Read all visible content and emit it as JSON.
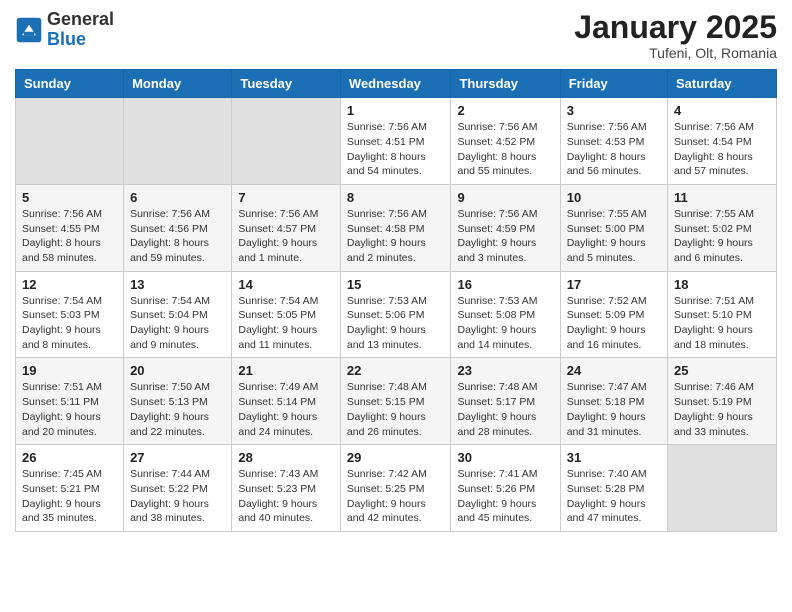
{
  "header": {
    "logo_general": "General",
    "logo_blue": "Blue",
    "month_title": "January 2025",
    "location": "Tufeni, Olt, Romania"
  },
  "weekdays": [
    "Sunday",
    "Monday",
    "Tuesday",
    "Wednesday",
    "Thursday",
    "Friday",
    "Saturday"
  ],
  "weeks": [
    [
      {
        "day": "",
        "info": ""
      },
      {
        "day": "",
        "info": ""
      },
      {
        "day": "",
        "info": ""
      },
      {
        "day": "1",
        "info": "Sunrise: 7:56 AM\nSunset: 4:51 PM\nDaylight: 8 hours\nand 54 minutes."
      },
      {
        "day": "2",
        "info": "Sunrise: 7:56 AM\nSunset: 4:52 PM\nDaylight: 8 hours\nand 55 minutes."
      },
      {
        "day": "3",
        "info": "Sunrise: 7:56 AM\nSunset: 4:53 PM\nDaylight: 8 hours\nand 56 minutes."
      },
      {
        "day": "4",
        "info": "Sunrise: 7:56 AM\nSunset: 4:54 PM\nDaylight: 8 hours\nand 57 minutes."
      }
    ],
    [
      {
        "day": "5",
        "info": "Sunrise: 7:56 AM\nSunset: 4:55 PM\nDaylight: 8 hours\nand 58 minutes."
      },
      {
        "day": "6",
        "info": "Sunrise: 7:56 AM\nSunset: 4:56 PM\nDaylight: 8 hours\nand 59 minutes."
      },
      {
        "day": "7",
        "info": "Sunrise: 7:56 AM\nSunset: 4:57 PM\nDaylight: 9 hours\nand 1 minute."
      },
      {
        "day": "8",
        "info": "Sunrise: 7:56 AM\nSunset: 4:58 PM\nDaylight: 9 hours\nand 2 minutes."
      },
      {
        "day": "9",
        "info": "Sunrise: 7:56 AM\nSunset: 4:59 PM\nDaylight: 9 hours\nand 3 minutes."
      },
      {
        "day": "10",
        "info": "Sunrise: 7:55 AM\nSunset: 5:00 PM\nDaylight: 9 hours\nand 5 minutes."
      },
      {
        "day": "11",
        "info": "Sunrise: 7:55 AM\nSunset: 5:02 PM\nDaylight: 9 hours\nand 6 minutes."
      }
    ],
    [
      {
        "day": "12",
        "info": "Sunrise: 7:54 AM\nSunset: 5:03 PM\nDaylight: 9 hours\nand 8 minutes."
      },
      {
        "day": "13",
        "info": "Sunrise: 7:54 AM\nSunset: 5:04 PM\nDaylight: 9 hours\nand 9 minutes."
      },
      {
        "day": "14",
        "info": "Sunrise: 7:54 AM\nSunset: 5:05 PM\nDaylight: 9 hours\nand 11 minutes."
      },
      {
        "day": "15",
        "info": "Sunrise: 7:53 AM\nSunset: 5:06 PM\nDaylight: 9 hours\nand 13 minutes."
      },
      {
        "day": "16",
        "info": "Sunrise: 7:53 AM\nSunset: 5:08 PM\nDaylight: 9 hours\nand 14 minutes."
      },
      {
        "day": "17",
        "info": "Sunrise: 7:52 AM\nSunset: 5:09 PM\nDaylight: 9 hours\nand 16 minutes."
      },
      {
        "day": "18",
        "info": "Sunrise: 7:51 AM\nSunset: 5:10 PM\nDaylight: 9 hours\nand 18 minutes."
      }
    ],
    [
      {
        "day": "19",
        "info": "Sunrise: 7:51 AM\nSunset: 5:11 PM\nDaylight: 9 hours\nand 20 minutes."
      },
      {
        "day": "20",
        "info": "Sunrise: 7:50 AM\nSunset: 5:13 PM\nDaylight: 9 hours\nand 22 minutes."
      },
      {
        "day": "21",
        "info": "Sunrise: 7:49 AM\nSunset: 5:14 PM\nDaylight: 9 hours\nand 24 minutes."
      },
      {
        "day": "22",
        "info": "Sunrise: 7:48 AM\nSunset: 5:15 PM\nDaylight: 9 hours\nand 26 minutes."
      },
      {
        "day": "23",
        "info": "Sunrise: 7:48 AM\nSunset: 5:17 PM\nDaylight: 9 hours\nand 28 minutes."
      },
      {
        "day": "24",
        "info": "Sunrise: 7:47 AM\nSunset: 5:18 PM\nDaylight: 9 hours\nand 31 minutes."
      },
      {
        "day": "25",
        "info": "Sunrise: 7:46 AM\nSunset: 5:19 PM\nDaylight: 9 hours\nand 33 minutes."
      }
    ],
    [
      {
        "day": "26",
        "info": "Sunrise: 7:45 AM\nSunset: 5:21 PM\nDaylight: 9 hours\nand 35 minutes."
      },
      {
        "day": "27",
        "info": "Sunrise: 7:44 AM\nSunset: 5:22 PM\nDaylight: 9 hours\nand 38 minutes."
      },
      {
        "day": "28",
        "info": "Sunrise: 7:43 AM\nSunset: 5:23 PM\nDaylight: 9 hours\nand 40 minutes."
      },
      {
        "day": "29",
        "info": "Sunrise: 7:42 AM\nSunset: 5:25 PM\nDaylight: 9 hours\nand 42 minutes."
      },
      {
        "day": "30",
        "info": "Sunrise: 7:41 AM\nSunset: 5:26 PM\nDaylight: 9 hours\nand 45 minutes."
      },
      {
        "day": "31",
        "info": "Sunrise: 7:40 AM\nSunset: 5:28 PM\nDaylight: 9 hours\nand 47 minutes."
      },
      {
        "day": "",
        "info": ""
      }
    ]
  ]
}
